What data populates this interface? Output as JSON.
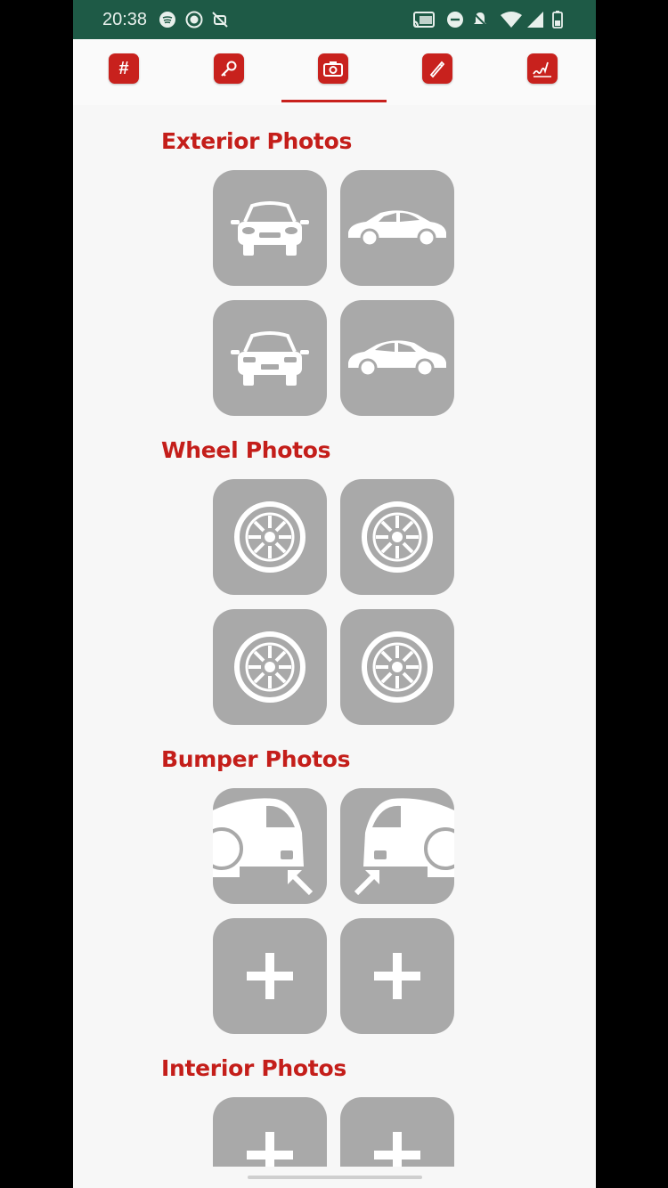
{
  "status": {
    "time": "20:38"
  },
  "tabs": [
    {
      "icon": "hash-icon",
      "glyph": "#"
    },
    {
      "icon": "key-icon"
    },
    {
      "icon": "camera-icon"
    },
    {
      "icon": "pen-icon"
    },
    {
      "icon": "signature-icon"
    }
  ],
  "active_tab": 2,
  "colors": {
    "accent": "#c8211d",
    "statusbar": "#1e5a46",
    "tile": "#a9a9a9"
  },
  "sections": {
    "exterior": {
      "title": "Exterior Photos"
    },
    "wheel": {
      "title": "Wheel Photos"
    },
    "bumper": {
      "title": "Bumper Photos"
    },
    "interior": {
      "title": "Interior Photos"
    }
  }
}
